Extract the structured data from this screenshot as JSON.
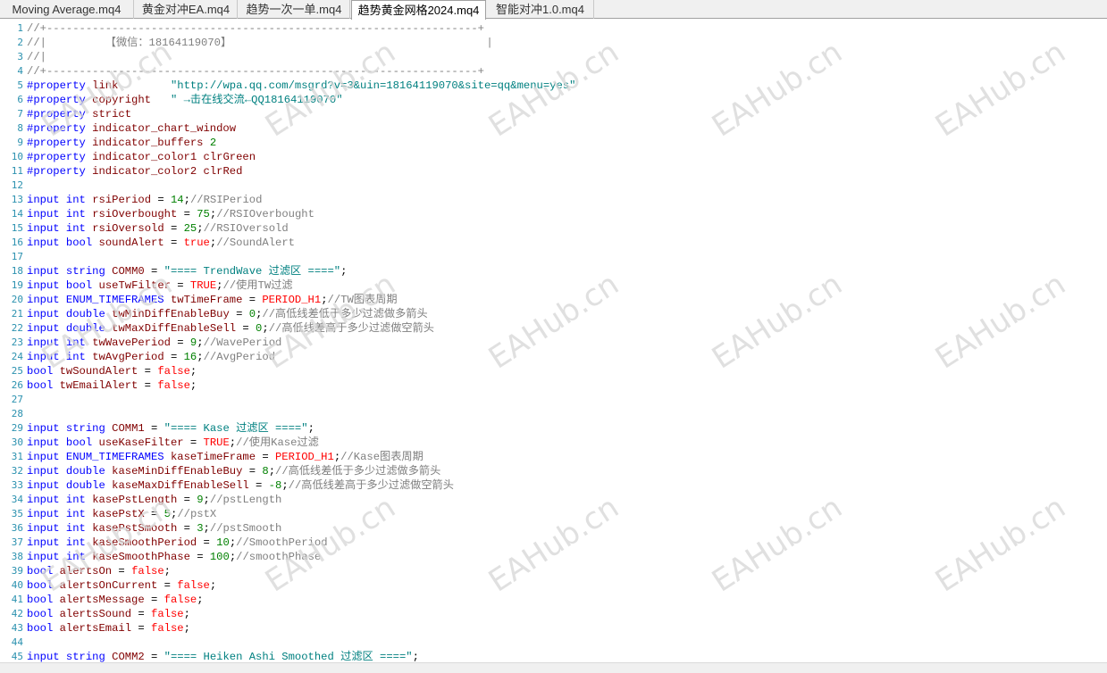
{
  "tabs": [
    {
      "label": "Moving Average.mq4",
      "active": false
    },
    {
      "label": "黄金对冲EA.mq4",
      "active": false
    },
    {
      "label": "趋势一次一单.mq4",
      "active": false
    },
    {
      "label": "趋势黄金网格2024.mq4",
      "active": true
    },
    {
      "label": "智能对冲1.0.mq4",
      "active": false
    }
  ],
  "watermark": "EAHub.cn",
  "colors": {
    "keyword": "#0000ff",
    "number": "#008000",
    "comment": "#808080",
    "string": "#008080",
    "constant": "#ff0000",
    "variable": "#800000",
    "line_number": "#2b91af"
  },
  "lines": [
    [
      [
        "cm",
        "//+------------------------------------------------------------------+"
      ]
    ],
    [
      [
        "cm",
        "//|         【微信：18164119070】                                       |"
      ]
    ],
    [
      [
        "cm",
        "//|"
      ]
    ],
    [
      [
        "cm",
        "//+------------------------------------------------------------------+"
      ]
    ],
    [
      [
        "pp",
        "#property"
      ],
      [
        "ct",
        " "
      ],
      [
        "vr",
        "link"
      ],
      [
        "ct",
        "        "
      ],
      [
        "str",
        "\"http://wpa.qq.com/msgrd?v=3&uin=18164119070&site=qq&menu=yes\""
      ]
    ],
    [
      [
        "pp",
        "#property"
      ],
      [
        "ct",
        " "
      ],
      [
        "vr",
        "copyright"
      ],
      [
        "ct",
        "   "
      ],
      [
        "str",
        "\" →击在线交流←QQ18164119070\""
      ]
    ],
    [
      [
        "pp",
        "#property"
      ],
      [
        "ct",
        " "
      ],
      [
        "vr",
        "strict"
      ]
    ],
    [
      [
        "pp",
        "#property"
      ],
      [
        "ct",
        " "
      ],
      [
        "vr",
        "indicator_chart_window"
      ]
    ],
    [
      [
        "pp",
        "#property"
      ],
      [
        "ct",
        " "
      ],
      [
        "vr",
        "indicator_buffers"
      ],
      [
        "ct",
        " "
      ],
      [
        "num",
        "2"
      ]
    ],
    [
      [
        "pp",
        "#property"
      ],
      [
        "ct",
        " "
      ],
      [
        "vr",
        "indicator_color1"
      ],
      [
        "ct",
        " "
      ],
      [
        "vr",
        "clrGreen"
      ]
    ],
    [
      [
        "pp",
        "#property"
      ],
      [
        "ct",
        " "
      ],
      [
        "vr",
        "indicator_color2"
      ],
      [
        "ct",
        " "
      ],
      [
        "vr",
        "clrRed"
      ]
    ],
    [],
    [
      [
        "kw",
        "input"
      ],
      [
        "ct",
        " "
      ],
      [
        "ty",
        "int"
      ],
      [
        "ct",
        " "
      ],
      [
        "vr",
        "rsiPeriod"
      ],
      [
        "ct",
        " = "
      ],
      [
        "num",
        "14"
      ],
      [
        "ct",
        ";"
      ],
      [
        "cm",
        "//RSIPeriod"
      ]
    ],
    [
      [
        "kw",
        "input"
      ],
      [
        "ct",
        " "
      ],
      [
        "ty",
        "int"
      ],
      [
        "ct",
        " "
      ],
      [
        "vr",
        "rsiOverbought"
      ],
      [
        "ct",
        " = "
      ],
      [
        "num",
        "75"
      ],
      [
        "ct",
        ";"
      ],
      [
        "cm",
        "//RSIOverbought"
      ]
    ],
    [
      [
        "kw",
        "input"
      ],
      [
        "ct",
        " "
      ],
      [
        "ty",
        "int"
      ],
      [
        "ct",
        " "
      ],
      [
        "vr",
        "rsiOversold"
      ],
      [
        "ct",
        " = "
      ],
      [
        "num",
        "25"
      ],
      [
        "ct",
        ";"
      ],
      [
        "cm",
        "//RSIOversold"
      ]
    ],
    [
      [
        "kw",
        "input"
      ],
      [
        "ct",
        " "
      ],
      [
        "ty",
        "bool"
      ],
      [
        "ct",
        " "
      ],
      [
        "vr",
        "soundAlert"
      ],
      [
        "ct",
        " = "
      ],
      [
        "cn",
        "true"
      ],
      [
        "ct",
        ";"
      ],
      [
        "cm",
        "//SoundAlert"
      ]
    ],
    [],
    [
      [
        "kw",
        "input"
      ],
      [
        "ct",
        " "
      ],
      [
        "ty",
        "string"
      ],
      [
        "ct",
        " "
      ],
      [
        "vr",
        "COMM0"
      ],
      [
        "ct",
        " = "
      ],
      [
        "str",
        "\"==== TrendWave 过滤区 ====\""
      ],
      [
        "ct",
        ";"
      ]
    ],
    [
      [
        "kw",
        "input"
      ],
      [
        "ct",
        " "
      ],
      [
        "ty",
        "bool"
      ],
      [
        "ct",
        " "
      ],
      [
        "vr",
        "useTwFilter"
      ],
      [
        "ct",
        " = "
      ],
      [
        "cn",
        "TRUE"
      ],
      [
        "ct",
        ";"
      ],
      [
        "cm",
        "//使用TW过滤"
      ]
    ],
    [
      [
        "kw",
        "input"
      ],
      [
        "ct",
        " "
      ],
      [
        "ty",
        "ENUM_TIMEFRAMES"
      ],
      [
        "ct",
        " "
      ],
      [
        "vr",
        "twTimeFrame"
      ],
      [
        "ct",
        " = "
      ],
      [
        "cn",
        "PERIOD_H1"
      ],
      [
        "ct",
        ";"
      ],
      [
        "cm",
        "//TW图表周期"
      ]
    ],
    [
      [
        "kw",
        "input"
      ],
      [
        "ct",
        " "
      ],
      [
        "ty",
        "double"
      ],
      [
        "ct",
        " "
      ],
      [
        "vr",
        "twMinDiffEnableBuy"
      ],
      [
        "ct",
        " = "
      ],
      [
        "num",
        "0"
      ],
      [
        "ct",
        ";"
      ],
      [
        "cm",
        "//高低线差低于多少过滤做多箭头"
      ]
    ],
    [
      [
        "kw",
        "input"
      ],
      [
        "ct",
        " "
      ],
      [
        "ty",
        "double"
      ],
      [
        "ct",
        " "
      ],
      [
        "vr",
        "twMaxDiffEnableSell"
      ],
      [
        "ct",
        " = "
      ],
      [
        "num",
        "0"
      ],
      [
        "ct",
        ";"
      ],
      [
        "cm",
        "//高低线差高于多少过滤做空箭头"
      ]
    ],
    [
      [
        "kw",
        "input"
      ],
      [
        "ct",
        " "
      ],
      [
        "ty",
        "int"
      ],
      [
        "ct",
        " "
      ],
      [
        "vr",
        "twWavePeriod"
      ],
      [
        "ct",
        " = "
      ],
      [
        "num",
        "9"
      ],
      [
        "ct",
        ";"
      ],
      [
        "cm",
        "//WavePeriod"
      ]
    ],
    [
      [
        "kw",
        "input"
      ],
      [
        "ct",
        " "
      ],
      [
        "ty",
        "int"
      ],
      [
        "ct",
        " "
      ],
      [
        "vr",
        "twAvgPeriod"
      ],
      [
        "ct",
        " = "
      ],
      [
        "num",
        "16"
      ],
      [
        "ct",
        ";"
      ],
      [
        "cm",
        "//AvgPeriod"
      ]
    ],
    [
      [
        "ty",
        "bool"
      ],
      [
        "ct",
        " "
      ],
      [
        "vr",
        "twSoundAlert"
      ],
      [
        "ct",
        " = "
      ],
      [
        "cn",
        "false"
      ],
      [
        "ct",
        ";"
      ]
    ],
    [
      [
        "ty",
        "bool"
      ],
      [
        "ct",
        " "
      ],
      [
        "vr",
        "twEmailAlert"
      ],
      [
        "ct",
        " = "
      ],
      [
        "cn",
        "false"
      ],
      [
        "ct",
        ";"
      ]
    ],
    [],
    [],
    [
      [
        "kw",
        "input"
      ],
      [
        "ct",
        " "
      ],
      [
        "ty",
        "string"
      ],
      [
        "ct",
        " "
      ],
      [
        "vr",
        "COMM1"
      ],
      [
        "ct",
        " = "
      ],
      [
        "str",
        "\"==== Kase 过滤区 ====\""
      ],
      [
        "ct",
        ";"
      ]
    ],
    [
      [
        "kw",
        "input"
      ],
      [
        "ct",
        " "
      ],
      [
        "ty",
        "bool"
      ],
      [
        "ct",
        " "
      ],
      [
        "vr",
        "useKaseFilter"
      ],
      [
        "ct",
        " = "
      ],
      [
        "cn",
        "TRUE"
      ],
      [
        "ct",
        ";"
      ],
      [
        "cm",
        "//使用Kase过滤"
      ]
    ],
    [
      [
        "kw",
        "input"
      ],
      [
        "ct",
        " "
      ],
      [
        "ty",
        "ENUM_TIMEFRAMES"
      ],
      [
        "ct",
        " "
      ],
      [
        "vr",
        "kaseTimeFrame"
      ],
      [
        "ct",
        " = "
      ],
      [
        "cn",
        "PERIOD_H1"
      ],
      [
        "ct",
        ";"
      ],
      [
        "cm",
        "//Kase图表周期"
      ]
    ],
    [
      [
        "kw",
        "input"
      ],
      [
        "ct",
        " "
      ],
      [
        "ty",
        "double"
      ],
      [
        "ct",
        " "
      ],
      [
        "vr",
        "kaseMinDiffEnableBuy"
      ],
      [
        "ct",
        " = "
      ],
      [
        "num",
        "8"
      ],
      [
        "ct",
        ";"
      ],
      [
        "cm",
        "//高低线差低于多少过滤做多箭头"
      ]
    ],
    [
      [
        "kw",
        "input"
      ],
      [
        "ct",
        " "
      ],
      [
        "ty",
        "double"
      ],
      [
        "ct",
        " "
      ],
      [
        "vr",
        "kaseMaxDiffEnableSell"
      ],
      [
        "ct",
        " = "
      ],
      [
        "num",
        "-8"
      ],
      [
        "ct",
        ";"
      ],
      [
        "cm",
        "//高低线差高于多少过滤做空箭头"
      ]
    ],
    [
      [
        "kw",
        "input"
      ],
      [
        "ct",
        " "
      ],
      [
        "ty",
        "int"
      ],
      [
        "ct",
        " "
      ],
      [
        "vr",
        "kasePstLength"
      ],
      [
        "ct",
        " = "
      ],
      [
        "num",
        "9"
      ],
      [
        "ct",
        ";"
      ],
      [
        "cm",
        "//pstLength"
      ]
    ],
    [
      [
        "kw",
        "input"
      ],
      [
        "ct",
        " "
      ],
      [
        "ty",
        "int"
      ],
      [
        "ct",
        " "
      ],
      [
        "vr",
        "kasePstX"
      ],
      [
        "ct",
        " = "
      ],
      [
        "num",
        "5"
      ],
      [
        "ct",
        ";"
      ],
      [
        "cm",
        "//pstX"
      ]
    ],
    [
      [
        "kw",
        "input"
      ],
      [
        "ct",
        " "
      ],
      [
        "ty",
        "int"
      ],
      [
        "ct",
        " "
      ],
      [
        "vr",
        "kasePstSmooth"
      ],
      [
        "ct",
        " = "
      ],
      [
        "num",
        "3"
      ],
      [
        "ct",
        ";"
      ],
      [
        "cm",
        "//pstSmooth"
      ]
    ],
    [
      [
        "kw",
        "input"
      ],
      [
        "ct",
        " "
      ],
      [
        "ty",
        "int"
      ],
      [
        "ct",
        " "
      ],
      [
        "vr",
        "kaseSmoothPeriod"
      ],
      [
        "ct",
        " = "
      ],
      [
        "num",
        "10"
      ],
      [
        "ct",
        ";"
      ],
      [
        "cm",
        "//SmoothPeriod"
      ]
    ],
    [
      [
        "kw",
        "input"
      ],
      [
        "ct",
        " "
      ],
      [
        "ty",
        "int"
      ],
      [
        "ct",
        " "
      ],
      [
        "vr",
        "kaseSmoothPhase"
      ],
      [
        "ct",
        " = "
      ],
      [
        "num",
        "100"
      ],
      [
        "ct",
        ";"
      ],
      [
        "cm",
        "//smoothPhase"
      ]
    ],
    [
      [
        "ty",
        "bool"
      ],
      [
        "ct",
        " "
      ],
      [
        "vr",
        "alertsOn"
      ],
      [
        "ct",
        " = "
      ],
      [
        "cn",
        "false"
      ],
      [
        "ct",
        ";"
      ]
    ],
    [
      [
        "ty",
        "bool"
      ],
      [
        "ct",
        " "
      ],
      [
        "vr",
        "alertsOnCurrent"
      ],
      [
        "ct",
        " = "
      ],
      [
        "cn",
        "false"
      ],
      [
        "ct",
        ";"
      ]
    ],
    [
      [
        "ty",
        "bool"
      ],
      [
        "ct",
        " "
      ],
      [
        "vr",
        "alertsMessage"
      ],
      [
        "ct",
        " = "
      ],
      [
        "cn",
        "false"
      ],
      [
        "ct",
        ";"
      ]
    ],
    [
      [
        "ty",
        "bool"
      ],
      [
        "ct",
        " "
      ],
      [
        "vr",
        "alertsSound"
      ],
      [
        "ct",
        " = "
      ],
      [
        "cn",
        "false"
      ],
      [
        "ct",
        ";"
      ]
    ],
    [
      [
        "ty",
        "bool"
      ],
      [
        "ct",
        " "
      ],
      [
        "vr",
        "alertsEmail"
      ],
      [
        "ct",
        " = "
      ],
      [
        "cn",
        "false"
      ],
      [
        "ct",
        ";"
      ]
    ],
    [],
    [
      [
        "kw",
        "input"
      ],
      [
        "ct",
        " "
      ],
      [
        "ty",
        "string"
      ],
      [
        "ct",
        " "
      ],
      [
        "vr",
        "COMM2"
      ],
      [
        "ct",
        " = "
      ],
      [
        "str",
        "\"==== Heiken Ashi Smoothed 过滤区 ====\""
      ],
      [
        "ct",
        ";"
      ]
    ]
  ]
}
